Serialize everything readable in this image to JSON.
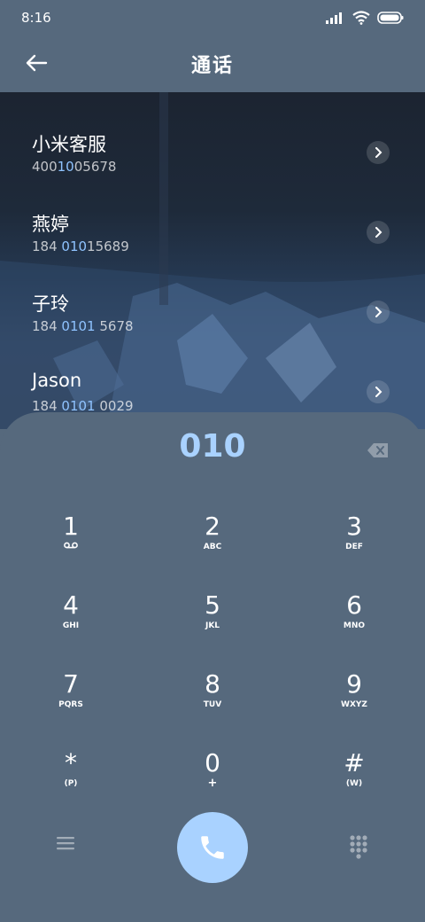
{
  "status_bar": {
    "time": "8:16"
  },
  "header": {
    "title": "通话"
  },
  "contacts": [
    {
      "name": "小米客服",
      "number_parts": [
        "400",
        "10",
        "05678"
      ]
    },
    {
      "name": "燕婷",
      "number_parts": [
        "184 ",
        "010",
        "15689"
      ]
    },
    {
      "name": "子玲",
      "number_parts": [
        "184 ",
        "0101",
        " 5678"
      ]
    },
    {
      "name": "Jason",
      "number_parts": [
        "184 ",
        "0101",
        " 0029"
      ]
    }
  ],
  "dialpad": {
    "input_value": "010",
    "keys": [
      {
        "digit": "1",
        "letters": ""
      },
      {
        "digit": "2",
        "letters": "ABC"
      },
      {
        "digit": "3",
        "letters": "DEF"
      },
      {
        "digit": "4",
        "letters": "GHI"
      },
      {
        "digit": "5",
        "letters": "JKL"
      },
      {
        "digit": "6",
        "letters": "MNO"
      },
      {
        "digit": "7",
        "letters": "PQRS"
      },
      {
        "digit": "8",
        "letters": "TUV"
      },
      {
        "digit": "9",
        "letters": "WXYZ"
      },
      {
        "digit": "*",
        "letters": "(P)"
      },
      {
        "digit": "0",
        "letters": "+"
      },
      {
        "digit": "#",
        "letters": "(W)"
      }
    ]
  },
  "icons": {
    "back": "arrow-left-icon",
    "signal": "signal-icon",
    "wifi": "wifi-icon",
    "battery": "battery-icon",
    "chevron": "chevron-right-icon",
    "backspace": "backspace-icon",
    "voicemail": "voicemail-icon",
    "menu": "menu-icon",
    "call": "phone-icon",
    "keypad": "keypad-icon"
  },
  "colors": {
    "background": "#56697d",
    "accent": "#a9d2ff",
    "highlight": "#8fc3ff"
  }
}
